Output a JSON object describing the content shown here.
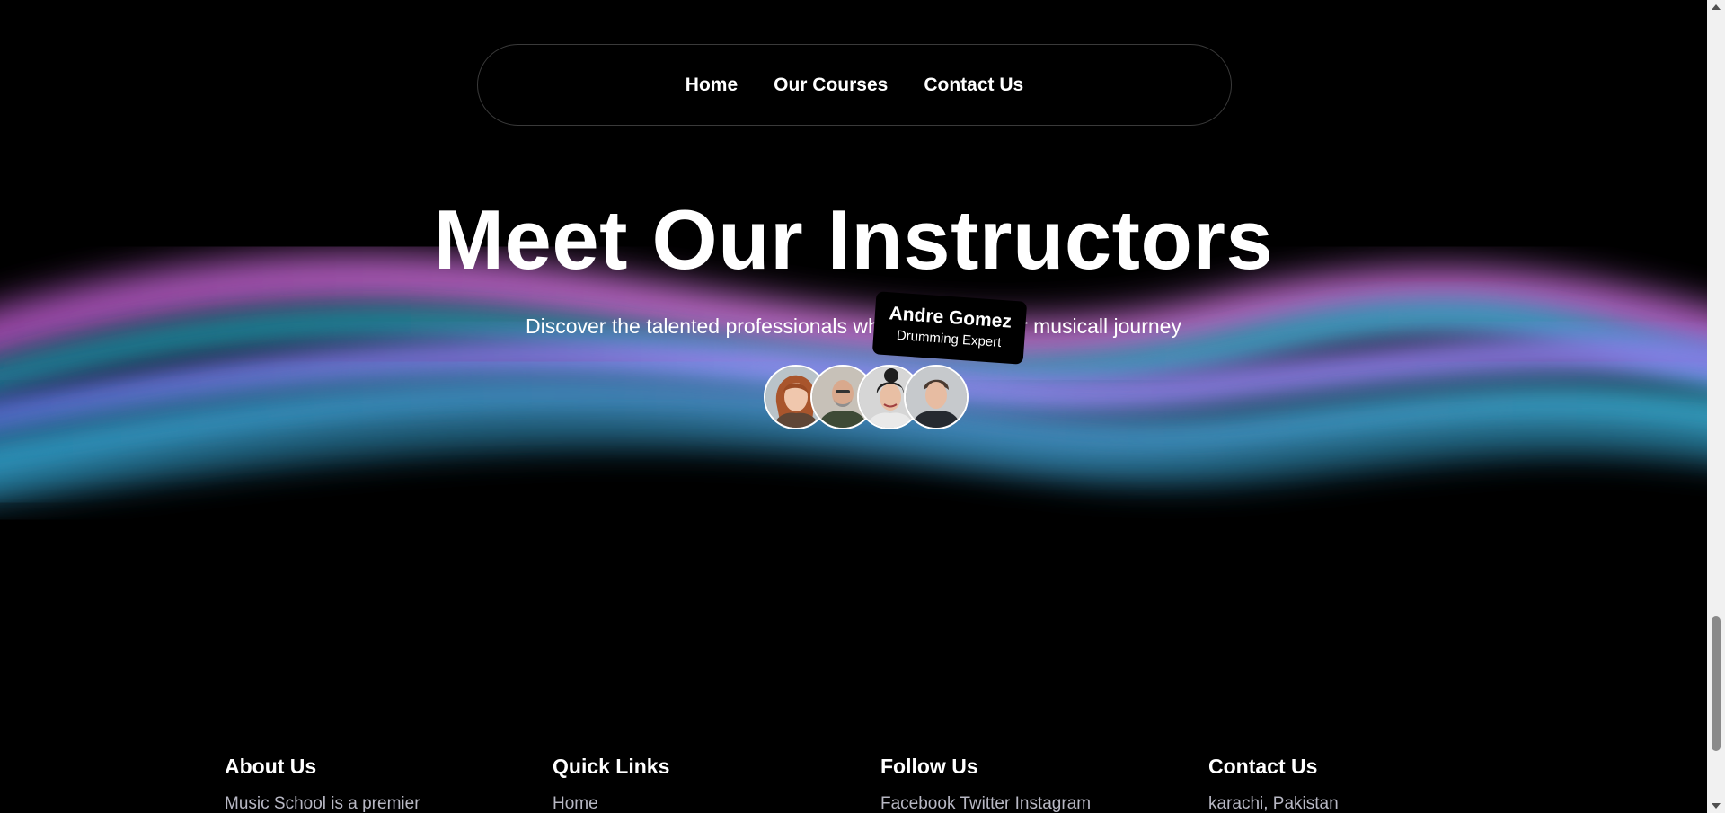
{
  "nav": {
    "items": [
      "Home",
      "Our Courses",
      "Contact Us"
    ]
  },
  "hero": {
    "title": "Meet Our Instructors",
    "subtitle": "Discover the talented professionals who will guide your musicall journey"
  },
  "tooltip": {
    "name": "Andre Gomez",
    "role": "Drumming Expert"
  },
  "instructors": [
    {
      "icon": "instructor-portrait-1"
    },
    {
      "icon": "instructor-portrait-2"
    },
    {
      "icon": "instructor-portrait-3"
    },
    {
      "icon": "instructor-portrait-4"
    }
  ],
  "footer": {
    "about": {
      "heading": "About Us",
      "text": "Music School is a premier"
    },
    "links": {
      "heading": "Quick Links",
      "text": "Home"
    },
    "follow": {
      "heading": "Follow Us",
      "text": "Facebook   Twitter   Instagram"
    },
    "contact": {
      "heading": "Contact Us",
      "text": "karachi, Pakistan"
    }
  },
  "colors": {
    "background": "#000000",
    "wave_pink": "#c86ad6",
    "wave_violet": "#9b7cf0",
    "wave_cyan": "#3bb7e6",
    "wave_teal": "#2a9fb0"
  }
}
